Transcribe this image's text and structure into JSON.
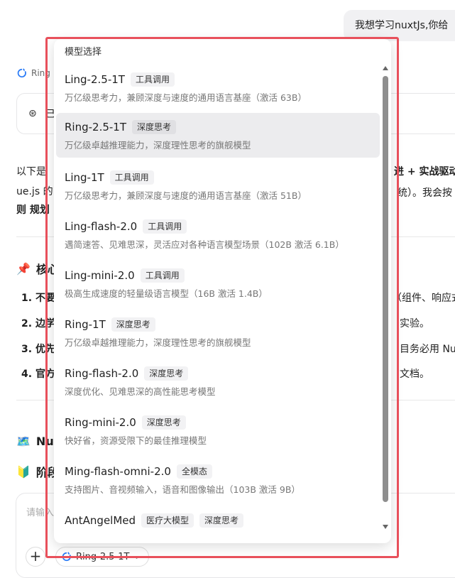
{
  "chat": {
    "user_message": "我想学习nuxtJs,你给",
    "model_name_partial": "Ring",
    "thinking_label_partial": "已",
    "paragraph_line1_left": "以下是",
    "paragraph_line1_right": "进 + 实战驱动",
    "paragraph_line2_left": "ue.js 的",
    "paragraph_line2_right": "统）。我会按",
    "paragraph_line3_left": "则 规划",
    "section1_icon": "📌",
    "section1_title_partial": "核心",
    "list_items": [
      {
        "num": "1.",
        "left": "不要",
        "right": "（组件、响应式"
      },
      {
        "num": "2.",
        "left": "边学",
        "right": "实验。"
      },
      {
        "num": "3.",
        "left": "优先",
        "right": "目务必用 Nuxt"
      },
      {
        "num": "4.",
        "left": "官方",
        "right": "文档。"
      }
    ],
    "section2_icon": "🗺️",
    "section2_title_partial": "Nu",
    "section3_icon": "🔰",
    "section3_title_partial": "阶段",
    "input_placeholder": "请输入",
    "plus_label": "+",
    "selected_model_pill": "Ring-2.5-1T"
  },
  "dropdown": {
    "header": "模型选择",
    "options": [
      {
        "name": "Ling-2.5-1T",
        "tags": [
          "工具调用"
        ],
        "desc": "万亿级思考力，兼顾深度与速度的通用语言基座（激活 63B）",
        "selected": false
      },
      {
        "name": "Ring-2.5-1T",
        "tags": [
          "深度思考"
        ],
        "desc": "万亿级卓越推理能力，深度理性思考的旗舰模型",
        "selected": true
      },
      {
        "name": "Ling-1T",
        "tags": [
          "工具调用"
        ],
        "desc": "万亿级思考力，兼顾深度与速度的通用语言基座（激活 51B）",
        "selected": false
      },
      {
        "name": "Ling-flash-2.0",
        "tags": [
          "工具调用"
        ],
        "desc": "遇简速答、见难思深，灵活应对各种语言模型场景（102B 激活 6.1B）",
        "selected": false
      },
      {
        "name": "Ling-mini-2.0",
        "tags": [
          "工具调用"
        ],
        "desc": "极高生成速度的轻量级语言模型（16B 激活 1.4B）",
        "selected": false
      },
      {
        "name": "Ring-1T",
        "tags": [
          "深度思考"
        ],
        "desc": "万亿级卓越推理能力，深度理性思考的旗舰模型",
        "selected": false
      },
      {
        "name": "Ring-flash-2.0",
        "tags": [
          "深度思考"
        ],
        "desc": "深度优化、见难思深的高性能思考模型",
        "selected": false
      },
      {
        "name": "Ring-mini-2.0",
        "tags": [
          "深度思考"
        ],
        "desc": "快好省，资源受限下的最佳推理模型",
        "selected": false
      },
      {
        "name": "Ming-flash-omni-2.0",
        "tags": [
          "全模态"
        ],
        "desc": "支持图片、音视频输入，语音和图像输出（103B 激活 9B）",
        "selected": false
      },
      {
        "name": "AntAngelMed",
        "tags": [
          "医疗大模型",
          "深度思考"
        ],
        "desc": "",
        "selected": false
      }
    ]
  },
  "colors": {
    "highlight_frame": "#e8505b",
    "selected_bg": "#ececee",
    "ring_icon": "#2b7cf7"
  }
}
